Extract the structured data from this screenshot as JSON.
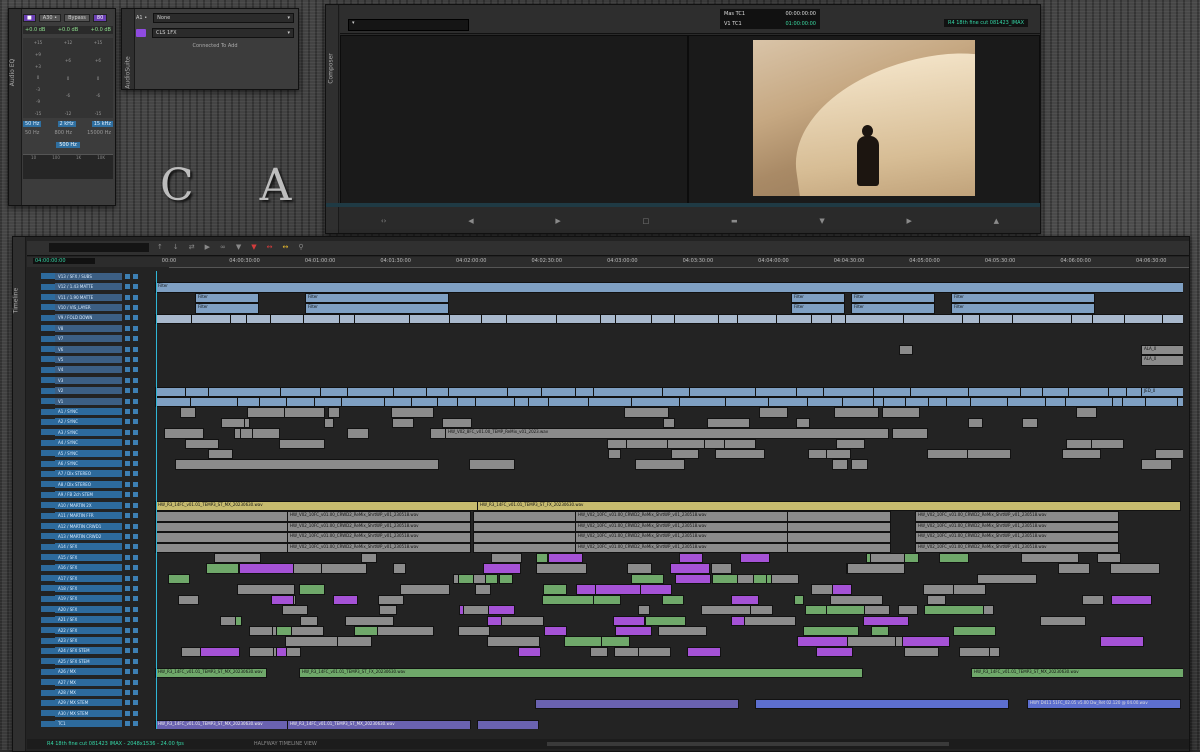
{
  "desktop": {
    "wallpaper_text": "C A"
  },
  "audio_eq": {
    "tab": "Audio EQ",
    "top_labels": [
      "A30 •",
      "Bypass",
      "80"
    ],
    "values": [
      "+0.0 dB",
      "+0.0 dB",
      "+0.0 dB"
    ],
    "db_scale": [
      "+15",
      "+12",
      "+9",
      "+6",
      "+3",
      "0",
      "-3",
      "-6",
      "-9",
      "-12",
      "-15"
    ],
    "freq_buttons": [
      "50 Hz",
      "2 kHz",
      "15 kHz"
    ],
    "freq_scale": [
      "50 Hz",
      "800 Hz",
      "15000 Hz"
    ],
    "center_freq": "500 Hz",
    "bottom_scale": [
      "10",
      "100",
      "1K",
      "10K"
    ]
  },
  "audiosuite": {
    "tab": "AudioSuite",
    "track_label": "A1 •",
    "plugin": "None",
    "preset": "CLS 1FX",
    "status": "Connected To Add"
  },
  "composer": {
    "tab": "Composer",
    "tc_rows": [
      {
        "label": "Mas  TC1",
        "value": "00:00:00:00"
      },
      {
        "label": "V1  TC1",
        "value": "01:00:00:00"
      }
    ],
    "sequence_name": "R4 18th fine cut 081423_IMAX"
  },
  "timeline": {
    "tab": "Timeline",
    "start_tc": "04:00:00:00",
    "ruler": [
      "00:00",
      "04:00:30:00",
      "04:01:00:00",
      "04:01:30:00",
      "04:02:00:00",
      "04:02:30:00",
      "04:03:00:00",
      "04:03:30:00",
      "04:04:00:00",
      "04:04:30:00",
      "04:05:00:00",
      "04:05:30:00",
      "04:06:00:00",
      "04:06:30:00"
    ],
    "tracks": [
      "V13 / SFX / SUBS",
      "V12 / 1.43 MATTE",
      "V11 / 1.90 MATTE",
      "V10 / VIS_LAYER",
      "V9 / FOLD DOWN",
      "V8",
      "V7",
      "V6",
      "V5",
      "V4",
      "V3",
      "V2",
      "V1",
      "A1 / SYNC",
      "A2 / SYNC",
      "A3 / SYNC",
      "A4 / SYNC",
      "A5 / SYNC",
      "A6 / SYNC",
      "A7 / Dlx STEREO",
      "A8 / Dlx STEREO",
      "A9 / FB 2ch STEM",
      "A10 / MARTIN 2X",
      "A11 / MARTIN FFR",
      "A12 / MARTIN CRWD1",
      "A13 / MARTIN CRWD2",
      "A14 / SFX",
      "A15 / SFX",
      "A16 / SFX",
      "A17 / SFX",
      "A18 / SFX",
      "A19 / SFX",
      "A20 / SFX",
      "A21 / SFX",
      "A22 / SFX",
      "A23 / SFX",
      "A24 / SFX STEM",
      "A25 / SFX STEM",
      "A26 / MX",
      "A27 / MX",
      "A28 / MX",
      "A29 / MX STEM",
      "A30 / MX STEM",
      "TC1"
    ],
    "clip_labels": {
      "filter": "Filter",
      "music_1": "HW_R3_14FC_v01.01_TEMP3_ST_MX_20230630.wav",
      "music_2": "HW_R3_14FC_v01.01_TEMP3_ST_FX_20230630.wav",
      "music_3": "HWY D411 51FC_02.05 v5.00 Dw_Ret 02.120 @ 04.00.wav",
      "crowd": "HW_V02_10FC_v01.00_CRWD2_ReMix_ShrtWP_v01_230518.wav",
      "pbs": "HW_V02_8FC_v01.00_TEMP_ReMix_v01_2023.wav",
      "ala": "ALA_0",
      "jed": "JED_0"
    },
    "status": {
      "sequence_info": "R4 18th fine cut 081423 IMAX - 2048x1536 - 24.00 fps",
      "view": "HALFWAY TIMELINE VIEW"
    }
  }
}
